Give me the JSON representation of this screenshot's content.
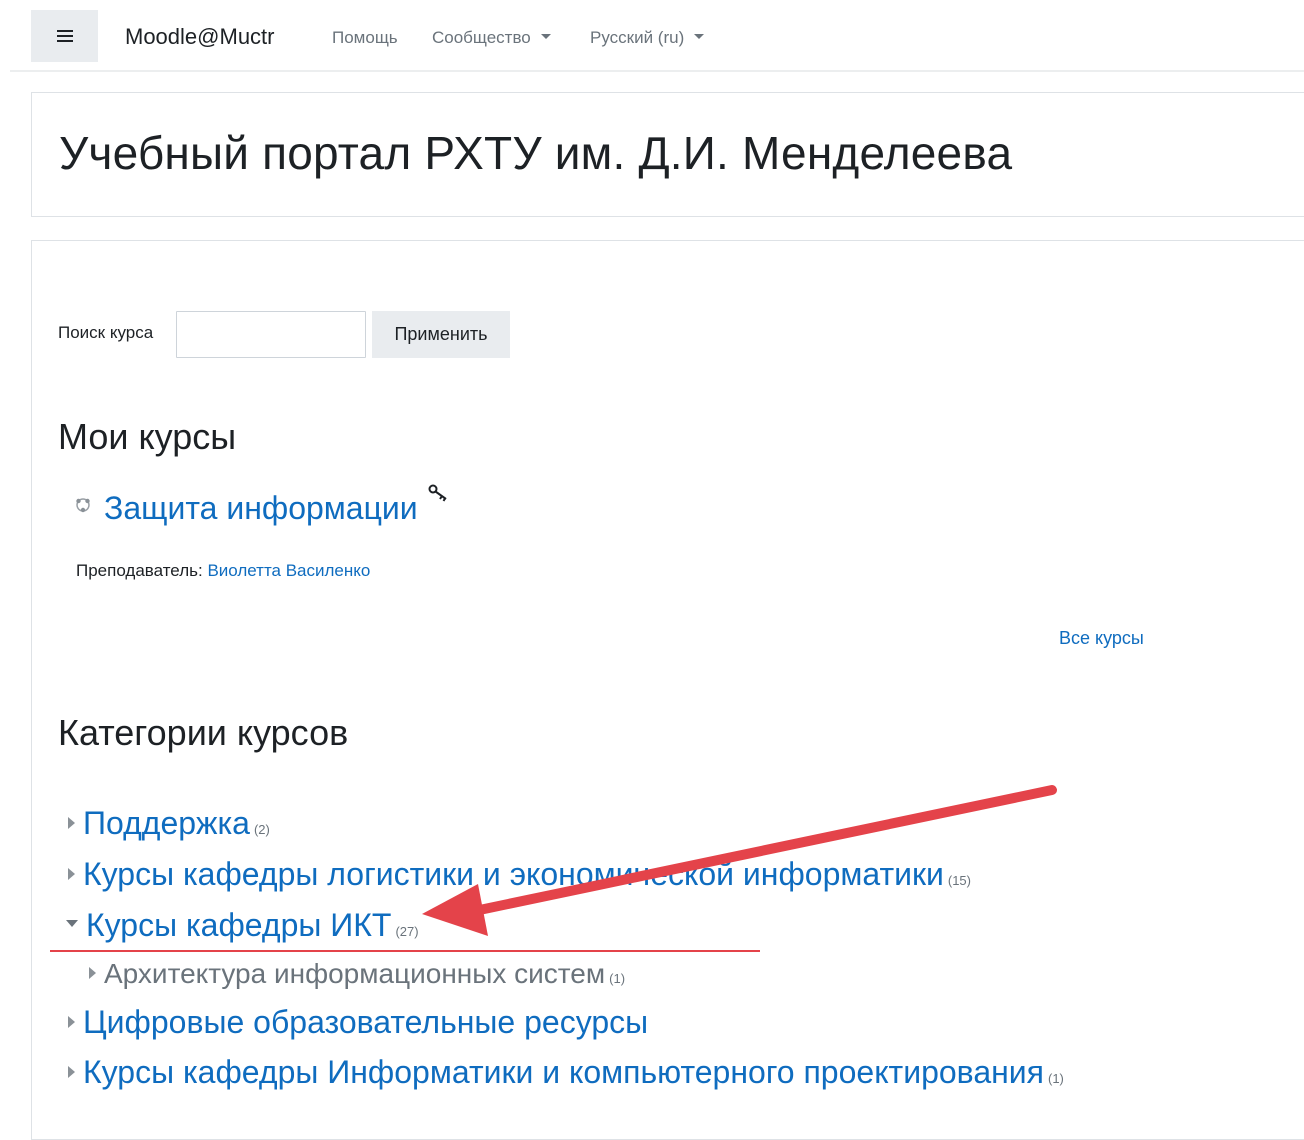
{
  "navbar": {
    "brand": "Moodle@Muctr",
    "help": "Помощь",
    "community": "Сообщество",
    "language": "Русский (ru)"
  },
  "header": {
    "title": "Учебный портал РХТУ им. Д.И. Менделеева"
  },
  "search": {
    "label": "Поиск курса",
    "value": "",
    "button": "Применить"
  },
  "my_courses": {
    "title": "Мои курсы",
    "course_name": "Защита информации",
    "teacher_label": "Преподаватель:",
    "teacher_name": "Виолетта Василенко",
    "all_courses": "Все курсы"
  },
  "categories": {
    "title": "Категории курсов",
    "items": [
      {
        "name": "Поддержка",
        "count": "(2)"
      },
      {
        "name": "Курсы кафедры логистики и экономической информатики",
        "count": "(15)"
      },
      {
        "name": "Курсы кафедры ИКТ",
        "count": "(27)"
      },
      {
        "name": "Архитектура информационных систем",
        "count": "(1)"
      },
      {
        "name": "Цифровые образовательные ресурсы",
        "count": ""
      },
      {
        "name": "Курсы кафедры Информатики и компьютерного проектирования",
        "count": "(1)"
      }
    ]
  },
  "colors": {
    "link": "#0f6cbf",
    "annotation_arrow": "#e4434a"
  }
}
